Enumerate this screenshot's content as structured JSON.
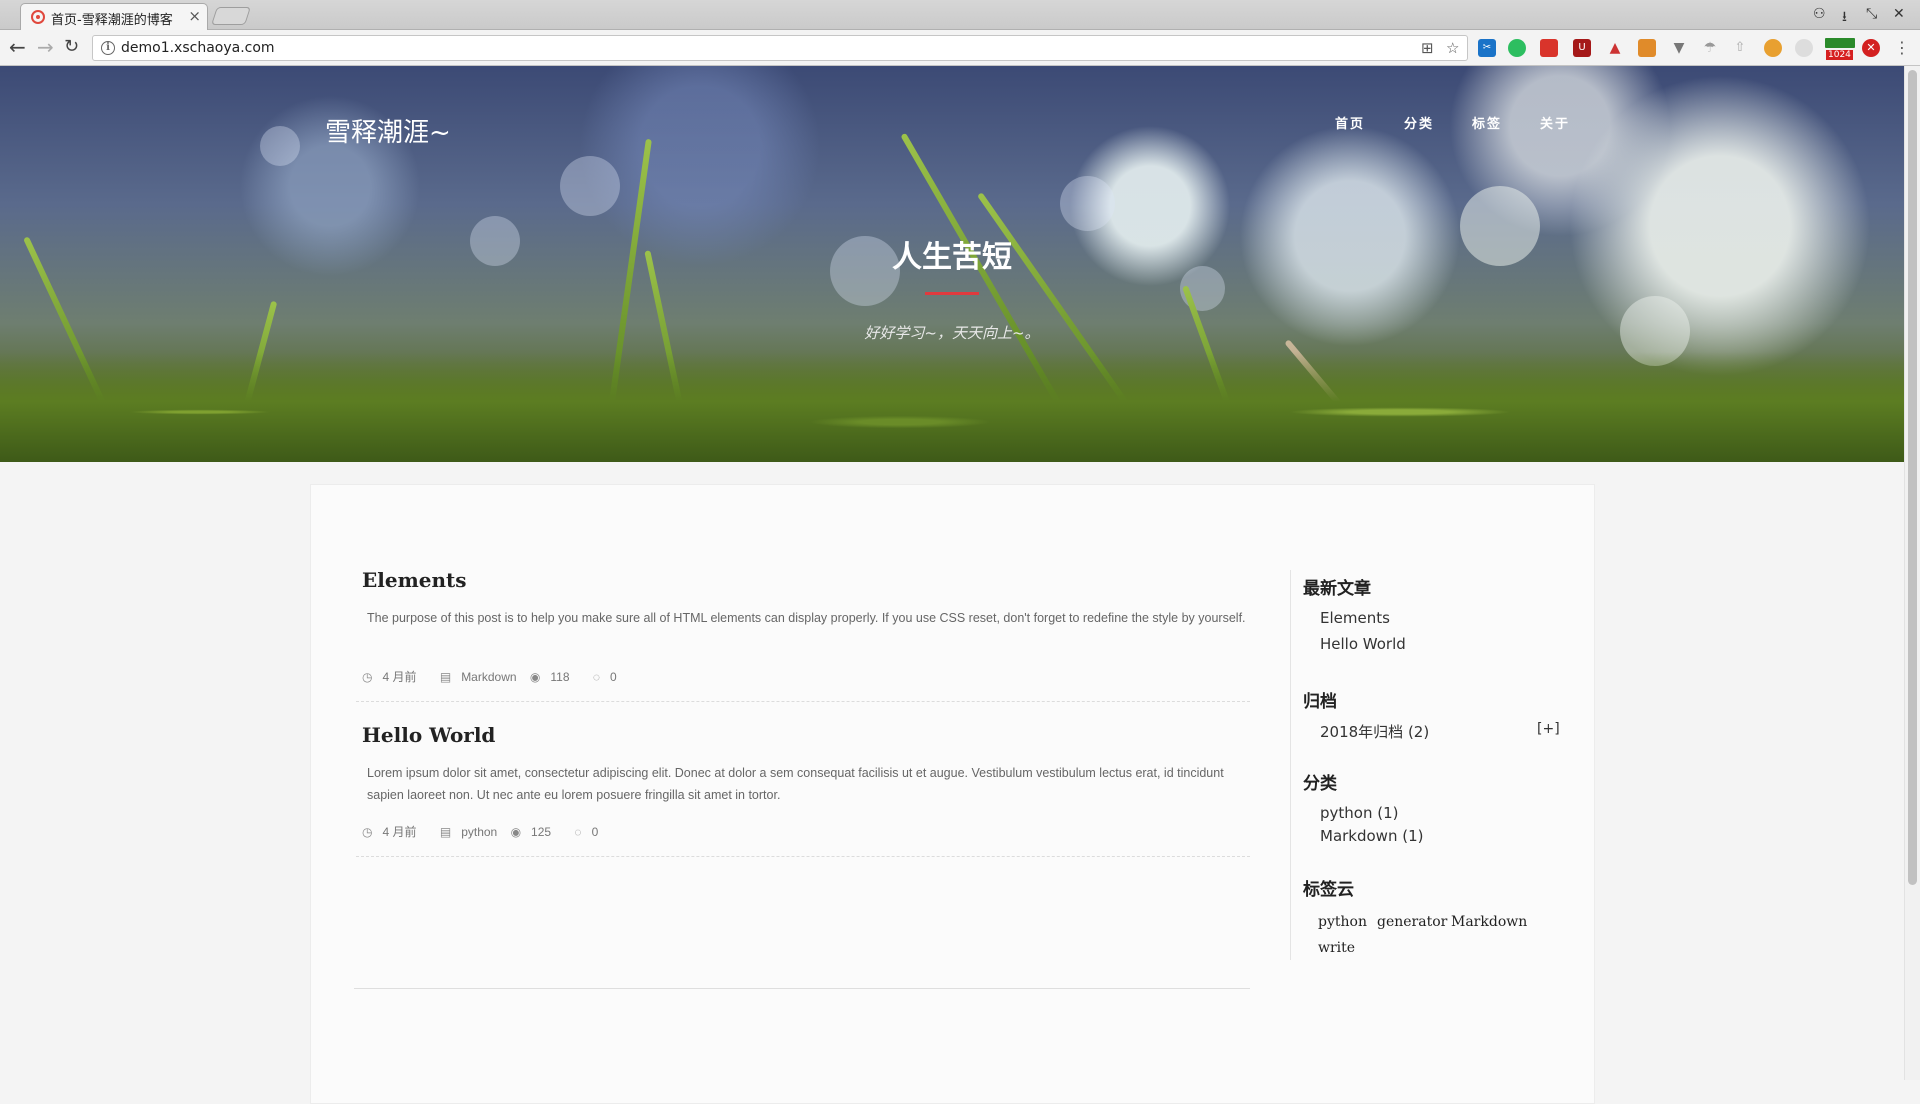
{
  "browser": {
    "tab_title": "首页-雪释潮涯的博客",
    "tab_close": "×",
    "url": "demo1.xschaoya.com",
    "ext_badge": "1024"
  },
  "site": {
    "title": "雪释潮涯~",
    "nav": [
      "首页",
      "分类",
      "标签",
      "关于"
    ]
  },
  "hero": {
    "heading": "人生苦短",
    "subtitle": "好好学习~，天天向上~。",
    "accent_color": "#e03a3e"
  },
  "posts": [
    {
      "title": "Elements",
      "excerpt": "The purpose of this post is to help you make sure all of HTML elements can display properly. If you use CSS reset, don't forget to redefine the style by yourself.",
      "date": "4 月前",
      "category": "Markdown",
      "views": "118",
      "comments": "0"
    },
    {
      "title": "Hello World",
      "excerpt": "Lorem ipsum dolor sit amet, consectetur adipiscing elit. Donec at dolor a sem consequat facilisis ut et augue. Vestibulum vestibulum lectus erat, id tincidunt sapien laoreet non. Ut nec ante eu lorem posuere fringilla sit amet in tortor.",
      "date": "4 月前",
      "category": "python",
      "views": "125",
      "comments": "0"
    }
  ],
  "sidebar": {
    "recent_title": "最新文章",
    "recent": [
      "Elements",
      "Hello World"
    ],
    "archive_title": "归档",
    "archive_item": "2018年归档 (2)",
    "archive_toggle": "[+]",
    "categories_title": "分类",
    "categories": [
      "python (1)",
      "Markdown (1)"
    ],
    "tags_title": "标签云",
    "tags": [
      "python",
      "generator",
      "Markdown",
      "write"
    ]
  }
}
